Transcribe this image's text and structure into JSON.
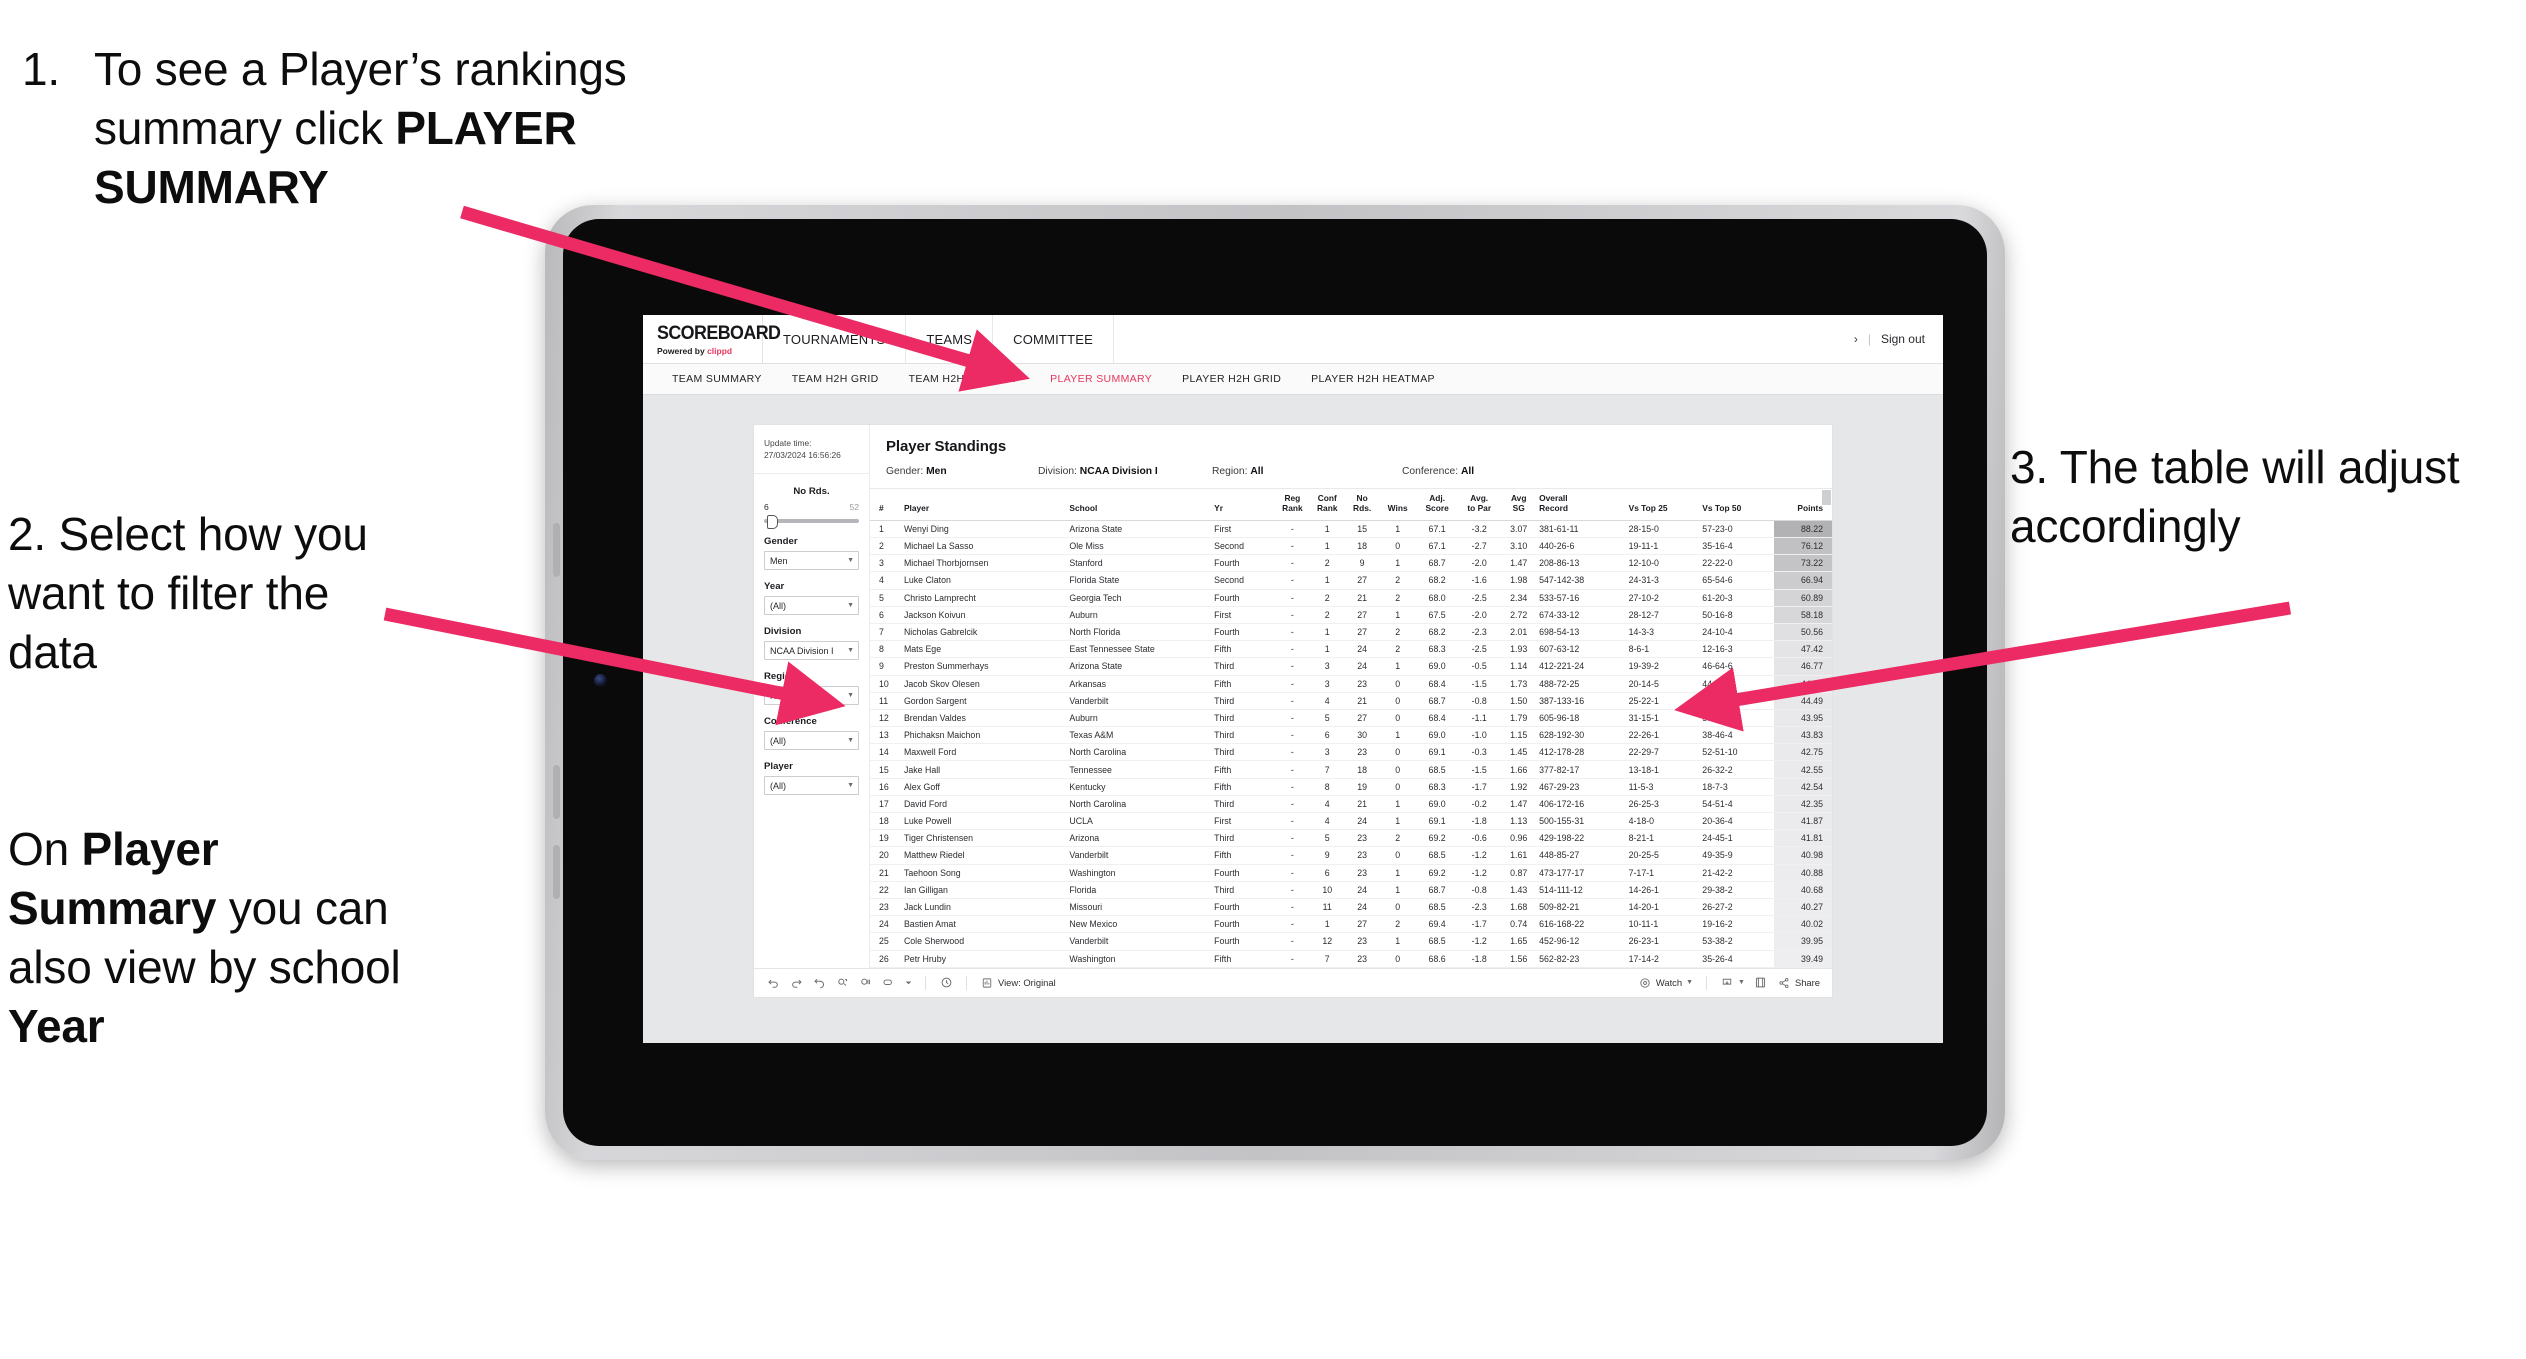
{
  "annotations": {
    "a1_number": "1.",
    "a1_text_part1": "To see a Player’s rankings summary click ",
    "a1_text_bold": "PLAYER SUMMARY",
    "a2_text": "2. Select how you want to filter the data",
    "a3_text": "3. The table will adjust accordingly",
    "a4_part1": "On ",
    "a4_bold1": "Player Summary",
    "a4_part2": " you can also view by school ",
    "a4_bold2": "Year"
  },
  "app": {
    "logo_main": "SCOREBOARD",
    "logo_sub_prefix": "Powered by ",
    "logo_sub_brand": "clippd",
    "topnav": [
      "TOURNAMENTS",
      "TEAMS",
      "COMMITTEE"
    ],
    "user_glyph": "›",
    "separator": "|",
    "sign_out": "Sign out",
    "subnav": [
      {
        "label": "TEAM SUMMARY",
        "active": false
      },
      {
        "label": "TEAM H2H GRID",
        "active": false
      },
      {
        "label": "TEAM H2H HEATMAP",
        "active": false
      },
      {
        "label": "PLAYER SUMMARY",
        "active": true
      },
      {
        "label": "PLAYER H2H GRID",
        "active": false
      },
      {
        "label": "PLAYER H2H HEATMAP",
        "active": false
      }
    ],
    "accent_color": "#e8365d"
  },
  "filters": {
    "update_label": "Update time:",
    "update_value": "27/03/2024 16:56:26",
    "slider": {
      "title": "No Rds.",
      "min": "6",
      "max": "52"
    },
    "groups": [
      {
        "label": "Gender",
        "value": "Men"
      },
      {
        "label": "Year",
        "value": "(All)"
      },
      {
        "label": "Division",
        "value": "NCAA Division I"
      },
      {
        "label": "Region",
        "value": "N/A"
      },
      {
        "label": "Conference",
        "value": "(All)"
      },
      {
        "label": "Player",
        "value": "(All)"
      }
    ]
  },
  "viz": {
    "title": "Player Standings",
    "breadcrumbs": [
      {
        "key": "Gender: ",
        "value": "Men"
      },
      {
        "key": "Division: ",
        "value": "NCAA Division I"
      },
      {
        "key": "Region: ",
        "value": "All"
      },
      {
        "key": "Conference: ",
        "value": "All"
      }
    ],
    "columns": [
      {
        "l1": "#",
        "l2": ""
      },
      {
        "l1": "Player",
        "l2": ""
      },
      {
        "l1": "School",
        "l2": ""
      },
      {
        "l1": "Yr",
        "l2": ""
      },
      {
        "l1": "Reg",
        "l2": "Rank"
      },
      {
        "l1": "Conf",
        "l2": "Rank"
      },
      {
        "l1": "No",
        "l2": "Rds."
      },
      {
        "l1": "Wins",
        "l2": ""
      },
      {
        "l1": "Adj.",
        "l2": "Score"
      },
      {
        "l1": "Avg.",
        "l2": "to Par"
      },
      {
        "l1": "Avg",
        "l2": "SG"
      },
      {
        "l1": "Overall",
        "l2": "Record"
      },
      {
        "l1": "Vs Top 25",
        "l2": ""
      },
      {
        "l1": "Vs Top 50",
        "l2": ""
      },
      {
        "l1": "Points",
        "l2": ""
      }
    ],
    "rows": [
      [
        "1",
        "Wenyi Ding",
        "Arizona State",
        "First",
        "-",
        "1",
        "15",
        "1",
        "67.1",
        "-3.2",
        "3.07",
        "381-61-11",
        "28-15-0",
        "57-23-0",
        "88.22"
      ],
      [
        "2",
        "Michael La Sasso",
        "Ole Miss",
        "Second",
        "-",
        "1",
        "18",
        "0",
        "67.1",
        "-2.7",
        "3.10",
        "440-26-6",
        "19-11-1",
        "35-16-4",
        "76.12"
      ],
      [
        "3",
        "Michael Thorbjornsen",
        "Stanford",
        "Fourth",
        "-",
        "2",
        "9",
        "1",
        "68.7",
        "-2.0",
        "1.47",
        "208-86-13",
        "12-10-0",
        "22-22-0",
        "73.22"
      ],
      [
        "4",
        "Luke Claton",
        "Florida State",
        "Second",
        "-",
        "1",
        "27",
        "2",
        "68.2",
        "-1.6",
        "1.98",
        "547-142-38",
        "24-31-3",
        "65-54-6",
        "66.94"
      ],
      [
        "5",
        "Christo Lamprecht",
        "Georgia Tech",
        "Fourth",
        "-",
        "2",
        "21",
        "2",
        "68.0",
        "-2.5",
        "2.34",
        "533-57-16",
        "27-10-2",
        "61-20-3",
        "60.89"
      ],
      [
        "6",
        "Jackson Koivun",
        "Auburn",
        "First",
        "-",
        "2",
        "27",
        "1",
        "67.5",
        "-2.0",
        "2.72",
        "674-33-12",
        "28-12-7",
        "50-16-8",
        "58.18"
      ],
      [
        "7",
        "Nicholas Gabrelcik",
        "North Florida",
        "Fourth",
        "-",
        "1",
        "27",
        "2",
        "68.2",
        "-2.3",
        "2.01",
        "698-54-13",
        "14-3-3",
        "24-10-4",
        "50.56"
      ],
      [
        "8",
        "Mats Ege",
        "East Tennessee State",
        "Fifth",
        "-",
        "1",
        "24",
        "2",
        "68.3",
        "-2.5",
        "1.93",
        "607-63-12",
        "8-6-1",
        "12-16-3",
        "47.42"
      ],
      [
        "9",
        "Preston Summerhays",
        "Arizona State",
        "Third",
        "-",
        "3",
        "24",
        "1",
        "69.0",
        "-0.5",
        "1.14",
        "412-221-24",
        "19-39-2",
        "46-64-6",
        "46.77"
      ],
      [
        "10",
        "Jacob Skov Olesen",
        "Arkansas",
        "Fifth",
        "-",
        "3",
        "23",
        "0",
        "68.4",
        "-1.5",
        "1.73",
        "488-72-25",
        "20-14-5",
        "44-26-8",
        "44.82"
      ],
      [
        "11",
        "Gordon Sargent",
        "Vanderbilt",
        "Third",
        "-",
        "4",
        "21",
        "0",
        "68.7",
        "-0.8",
        "1.50",
        "387-133-16",
        "25-22-1",
        "47-40-3",
        "44.49"
      ],
      [
        "12",
        "Brendan Valdes",
        "Auburn",
        "Third",
        "-",
        "5",
        "27",
        "0",
        "68.4",
        "-1.1",
        "1.79",
        "605-96-18",
        "31-15-1",
        "50-18-5",
        "43.95"
      ],
      [
        "13",
        "Phichaksn Maichon",
        "Texas A&M",
        "Third",
        "-",
        "6",
        "30",
        "1",
        "69.0",
        "-1.0",
        "1.15",
        "628-192-30",
        "22-26-1",
        "38-46-4",
        "43.83"
      ],
      [
        "14",
        "Maxwell Ford",
        "North Carolina",
        "Third",
        "-",
        "3",
        "23",
        "0",
        "69.1",
        "-0.3",
        "1.45",
        "412-178-28",
        "22-29-7",
        "52-51-10",
        "42.75"
      ],
      [
        "15",
        "Jake Hall",
        "Tennessee",
        "Fifth",
        "-",
        "7",
        "18",
        "0",
        "68.5",
        "-1.5",
        "1.66",
        "377-82-17",
        "13-18-1",
        "26-32-2",
        "42.55"
      ],
      [
        "16",
        "Alex Goff",
        "Kentucky",
        "Fifth",
        "-",
        "8",
        "19",
        "0",
        "68.3",
        "-1.7",
        "1.92",
        "467-29-23",
        "11-5-3",
        "18-7-3",
        "42.54"
      ],
      [
        "17",
        "David Ford",
        "North Carolina",
        "Third",
        "-",
        "4",
        "21",
        "1",
        "69.0",
        "-0.2",
        "1.47",
        "406-172-16",
        "26-25-3",
        "54-51-4",
        "42.35"
      ],
      [
        "18",
        "Luke Powell",
        "UCLA",
        "First",
        "-",
        "4",
        "24",
        "1",
        "69.1",
        "-1.8",
        "1.13",
        "500-155-31",
        "4-18-0",
        "20-36-4",
        "41.87"
      ],
      [
        "19",
        "Tiger Christensen",
        "Arizona",
        "Third",
        "-",
        "5",
        "23",
        "2",
        "69.2",
        "-0.6",
        "0.96",
        "429-198-22",
        "8-21-1",
        "24-45-1",
        "41.81"
      ],
      [
        "20",
        "Matthew Riedel",
        "Vanderbilt",
        "Fifth",
        "-",
        "9",
        "23",
        "0",
        "68.5",
        "-1.2",
        "1.61",
        "448-85-27",
        "20-25-5",
        "49-35-9",
        "40.98"
      ],
      [
        "21",
        "Taehoon Song",
        "Washington",
        "Fourth",
        "-",
        "6",
        "23",
        "1",
        "69.2",
        "-1.2",
        "0.87",
        "473-177-17",
        "7-17-1",
        "21-42-2",
        "40.88"
      ],
      [
        "22",
        "Ian Gilligan",
        "Florida",
        "Third",
        "-",
        "10",
        "24",
        "1",
        "68.7",
        "-0.8",
        "1.43",
        "514-111-12",
        "14-26-1",
        "29-38-2",
        "40.68"
      ],
      [
        "23",
        "Jack Lundin",
        "Missouri",
        "Fourth",
        "-",
        "11",
        "24",
        "0",
        "68.5",
        "-2.3",
        "1.68",
        "509-82-21",
        "14-20-1",
        "26-27-2",
        "40.27"
      ],
      [
        "24",
        "Bastien Amat",
        "New Mexico",
        "Fourth",
        "-",
        "1",
        "27",
        "2",
        "69.4",
        "-1.7",
        "0.74",
        "616-168-22",
        "10-11-1",
        "19-16-2",
        "40.02"
      ],
      [
        "25",
        "Cole Sherwood",
        "Vanderbilt",
        "Fourth",
        "-",
        "12",
        "23",
        "1",
        "68.5",
        "-1.2",
        "1.65",
        "452-96-12",
        "26-23-1",
        "53-38-2",
        "39.95"
      ],
      [
        "26",
        "Petr Hruby",
        "Washington",
        "Fifth",
        "-",
        "7",
        "23",
        "0",
        "68.6",
        "-1.8",
        "1.56",
        "562-82-23",
        "17-14-2",
        "35-26-4",
        "39.49"
      ]
    ]
  },
  "toolbar": {
    "view_label": "View: Original",
    "watch_label": "Watch",
    "share_label": "Share",
    "icons": [
      "undo-icon",
      "redo-icon",
      "revert-icon",
      "refresh-icon",
      "pause-icon",
      "rect-select-icon",
      "dropdown-icon",
      "clock-icon",
      "view-icon",
      "watch-icon",
      "download-icon",
      "fullscreen-icon",
      "share-icon"
    ]
  }
}
